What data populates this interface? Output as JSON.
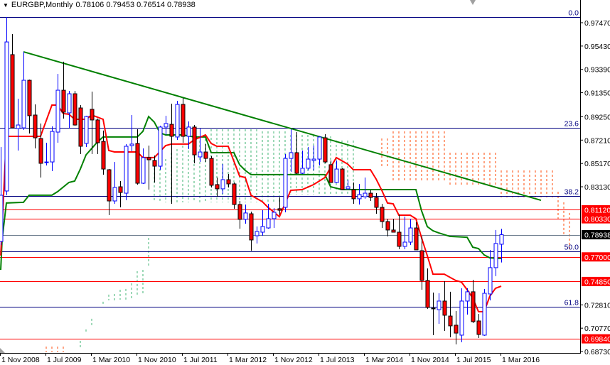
{
  "header": {
    "symbol": "EURGBP,Monthly",
    "ohlc": "0.78106 0.79453 0.76514 0.78938"
  },
  "colors": {
    "bull": "#0000ff",
    "bear": "#ff0000",
    "fib": "#000080",
    "level": "#ff0000",
    "trendline": "#008000",
    "red_line": "#ff0000",
    "green_line": "#008000",
    "cloud_green": "#3cb371",
    "cloud_orange": "#ff4500",
    "current_price": "#708090"
  },
  "chart_data": {
    "type": "candlestick",
    "title": "EURGBP,Monthly",
    "ylim": [
      0.6873,
      0.9797
    ],
    "y_ticks": [
      "0.97470",
      "0.95430",
      "0.93390",
      "0.91350",
      "0.89250",
      "0.87210",
      "0.85170",
      "0.83130",
      "0.72810",
      "0.70770",
      "0.68730"
    ],
    "x_ticks": [
      {
        "label": "1 Nov 2008",
        "index": 0
      },
      {
        "label": "1 Jul 2009",
        "index": 8
      },
      {
        "label": "1 Mar 2010",
        "index": 16
      },
      {
        "label": "1 Nov 2010",
        "index": 24
      },
      {
        "label": "1 Jul 2011",
        "index": 32
      },
      {
        "label": "1 Mar 2012",
        "index": 40
      },
      {
        "label": "1 Nov 2012",
        "index": 48
      },
      {
        "label": "1 Jul 2013",
        "index": 56
      },
      {
        "label": "1 Mar 2014",
        "index": 64
      },
      {
        "label": "1 Nov 2014",
        "index": 72
      },
      {
        "label": "1 Jul 2015",
        "index": 80
      },
      {
        "label": "1 Mar 2016",
        "index": 88
      }
    ],
    "candles_ohlc": [
      [
        0.7835,
        0.8661,
        0.7804,
        0.8239
      ],
      [
        0.8276,
        0.9797,
        0.8239,
        0.9579
      ],
      [
        0.9468,
        0.9648,
        0.8828,
        0.8828
      ],
      [
        0.8822,
        0.9083,
        0.863,
        0.8853
      ],
      [
        0.8828,
        0.9493,
        0.881,
        0.9244
      ],
      [
        0.9244,
        0.925,
        0.8779,
        0.8934
      ],
      [
        0.894,
        0.9033,
        0.8648,
        0.8741
      ],
      [
        0.8735,
        0.8866,
        0.8394,
        0.8518
      ],
      [
        0.8524,
        0.8698,
        0.8499,
        0.853
      ],
      [
        0.853,
        0.8841,
        0.845,
        0.8797
      ],
      [
        0.8791,
        0.93,
        0.8698,
        0.9157
      ],
      [
        0.9157,
        0.9406,
        0.8909,
        0.8965
      ],
      [
        0.8959,
        0.9151,
        0.8828,
        0.9126
      ],
      [
        0.9126,
        0.9151,
        0.8847,
        0.8853
      ],
      [
        0.9002,
        0.9027,
        0.8599,
        0.8667
      ],
      [
        0.8692,
        0.8934,
        0.8661,
        0.8928
      ],
      [
        0.899,
        0.9145,
        0.8599,
        0.8897
      ],
      [
        0.8897,
        0.8909,
        0.8599,
        0.8698
      ],
      [
        0.871,
        0.8804,
        0.8419,
        0.8468
      ],
      [
        0.8462,
        0.8468,
        0.8065,
        0.8189
      ],
      [
        0.8189,
        0.853,
        0.8164,
        0.8307
      ],
      [
        0.8313,
        0.8363,
        0.8133,
        0.8263
      ],
      [
        0.8257,
        0.8686,
        0.8195,
        0.8667
      ],
      [
        0.8673,
        0.894,
        0.8624,
        0.8686
      ],
      [
        0.8692,
        0.8816,
        0.8332,
        0.8344
      ],
      [
        0.8344,
        0.8648,
        0.8338,
        0.8568
      ],
      [
        0.8568,
        0.8673,
        0.8288,
        0.8549
      ],
      [
        0.8543,
        0.8586,
        0.835,
        0.8493
      ],
      [
        0.8493,
        0.8847,
        0.8462,
        0.8835
      ],
      [
        0.8835,
        0.8934,
        0.8766,
        0.8866
      ],
      [
        0.8859,
        0.9039,
        0.8164,
        0.8754
      ],
      [
        0.8748,
        0.9064,
        0.8723,
        0.9033
      ],
      [
        0.9033,
        0.9089,
        0.8698,
        0.8754
      ],
      [
        0.8754,
        0.8884,
        0.8642,
        0.8835
      ],
      [
        0.8835,
        0.8853,
        0.8518,
        0.8592
      ],
      [
        0.8574,
        0.8822,
        0.853,
        0.8617
      ],
      [
        0.8617,
        0.8686,
        0.853,
        0.8561
      ],
      [
        0.8561,
        0.858,
        0.8307,
        0.8326
      ],
      [
        0.8332,
        0.8394,
        0.8226,
        0.8295
      ],
      [
        0.8295,
        0.8512,
        0.8251,
        0.8375
      ],
      [
        0.8375,
        0.8425,
        0.8307,
        0.8338
      ],
      [
        0.8338,
        0.835,
        0.8121,
        0.8158
      ],
      [
        0.8158,
        0.8189,
        0.7947,
        0.8028
      ],
      [
        0.8028,
        0.8158,
        0.799,
        0.8084
      ],
      [
        0.8077,
        0.8096,
        0.7754,
        0.7848
      ],
      [
        0.7885,
        0.7966,
        0.7817,
        0.7922
      ],
      [
        0.7916,
        0.8108,
        0.7885,
        0.7966
      ],
      [
        0.7953,
        0.8164,
        0.7947,
        0.8034
      ],
      [
        0.8034,
        0.8127,
        0.7953,
        0.809
      ],
      [
        0.8121,
        0.822,
        0.8065,
        0.8108
      ],
      [
        0.8133,
        0.8599,
        0.809,
        0.8561
      ],
      [
        0.8561,
        0.8816,
        0.8444,
        0.8611
      ],
      [
        0.8611,
        0.8791,
        0.8425,
        0.8431
      ],
      [
        0.8431,
        0.863,
        0.8425,
        0.8475
      ],
      [
        0.8475,
        0.8661,
        0.8456,
        0.8555
      ],
      [
        0.8543,
        0.8673,
        0.8456,
        0.8555
      ],
      [
        0.8555,
        0.8754,
        0.8499,
        0.8748
      ],
      [
        0.8741,
        0.8773,
        0.8518,
        0.853
      ],
      [
        0.8506,
        0.8543,
        0.835,
        0.835
      ],
      [
        0.835,
        0.8543,
        0.8344,
        0.8468
      ],
      [
        0.8468,
        0.8475,
        0.8288,
        0.8288
      ],
      [
        0.8295,
        0.8375,
        0.8288,
        0.8313
      ],
      [
        0.8288,
        0.835,
        0.8164,
        0.8208
      ],
      [
        0.8208,
        0.8338,
        0.8158,
        0.8245
      ],
      [
        0.8226,
        0.8394,
        0.8208,
        0.8257
      ],
      [
        0.8257,
        0.8282,
        0.8189,
        0.822
      ],
      [
        0.822,
        0.8257,
        0.8077,
        0.8133
      ],
      [
        0.8133,
        0.8164,
        0.7953,
        0.8009
      ],
      [
        0.8009,
        0.8034,
        0.7879,
        0.7935
      ],
      [
        0.7935,
        0.8034,
        0.7916,
        0.7916
      ],
      [
        0.7916,
        0.8071,
        0.7767,
        0.7792
      ],
      [
        0.7792,
        0.8052,
        0.7767,
        0.7829
      ],
      [
        0.7829,
        0.8034,
        0.7804,
        0.7953
      ],
      [
        0.7953,
        0.8003,
        0.7761,
        0.7761
      ],
      [
        0.7754,
        0.7879,
        0.7413,
        0.7494
      ],
      [
        0.7494,
        0.7599,
        0.7246,
        0.7258
      ],
      [
        0.7252,
        0.7388,
        0.7016,
        0.7246
      ],
      [
        0.7239,
        0.7382,
        0.7115,
        0.7314
      ],
      [
        0.7314,
        0.7488,
        0.7053,
        0.719
      ],
      [
        0.7183,
        0.7395,
        0.6997,
        0.7097
      ],
      [
        0.7103,
        0.7227,
        0.6935,
        0.7034
      ],
      [
        0.7016,
        0.7426,
        0.6954,
        0.7314
      ],
      [
        0.7314,
        0.7426,
        0.7196,
        0.7395
      ],
      [
        0.7395,
        0.75,
        0.7121,
        0.7134
      ],
      [
        0.714,
        0.7202,
        0.6991,
        0.7022
      ],
      [
        0.7016,
        0.7419,
        0.701,
        0.7382
      ],
      [
        0.7376,
        0.7761,
        0.732,
        0.7606
      ],
      [
        0.7606,
        0.7935,
        0.7531,
        0.7817
      ],
      [
        0.78106,
        0.79453,
        0.76514,
        0.78938
      ]
    ],
    "red_line": [
      [
        0,
        0.7712
      ],
      [
        1,
        0.8754
      ],
      [
        7,
        0.8754
      ],
      [
        9,
        0.9027
      ],
      [
        10,
        0.9027
      ],
      [
        11,
        0.8953
      ],
      [
        12,
        0.8947
      ],
      [
        13,
        0.8903
      ],
      [
        15,
        0.8903
      ],
      [
        16,
        0.894
      ],
      [
        17,
        0.8922
      ],
      [
        18,
        0.8903
      ],
      [
        19,
        0.863
      ],
      [
        20,
        0.8617
      ],
      [
        24,
        0.8617
      ],
      [
        25,
        0.8568
      ],
      [
        27,
        0.8568
      ],
      [
        29,
        0.8673
      ],
      [
        30,
        0.8686
      ],
      [
        33,
        0.8686
      ],
      [
        34,
        0.8723
      ],
      [
        36,
        0.8766
      ],
      [
        37,
        0.8692
      ],
      [
        38,
        0.8667
      ],
      [
        40,
        0.8667
      ],
      [
        42,
        0.8406
      ],
      [
        43,
        0.8394
      ],
      [
        44,
        0.8239
      ],
      [
        46,
        0.8183
      ],
      [
        47,
        0.8133
      ],
      [
        49,
        0.8052
      ],
      [
        51,
        0.8282
      ],
      [
        53,
        0.8288
      ],
      [
        55,
        0.8332
      ],
      [
        57,
        0.8394
      ],
      [
        59,
        0.8568
      ],
      [
        61,
        0.8512
      ],
      [
        62,
        0.8462
      ],
      [
        65,
        0.8462
      ],
      [
        66,
        0.8381
      ],
      [
        67,
        0.8282
      ],
      [
        68,
        0.8171
      ],
      [
        69,
        0.8164
      ],
      [
        70,
        0.8065
      ],
      [
        72,
        0.8065
      ],
      [
        73,
        0.8034
      ],
      [
        74,
        0.7866
      ],
      [
        75,
        0.7711
      ],
      [
        76,
        0.7549
      ],
      [
        78,
        0.7549
      ],
      [
        80,
        0.7494
      ],
      [
        81,
        0.7481
      ],
      [
        82,
        0.7413
      ],
      [
        83,
        0.7339
      ],
      [
        84,
        0.7221
      ],
      [
        85,
        0.7221
      ],
      [
        86,
        0.7357
      ],
      [
        87,
        0.7426
      ],
      [
        88,
        0.7444
      ]
    ],
    "green_line": [
      [
        0,
        0.7587
      ],
      [
        0.25,
        0.7854
      ],
      [
        1,
        0.8171
      ],
      [
        4,
        0.8177
      ],
      [
        5,
        0.8239
      ],
      [
        9,
        0.8239
      ],
      [
        10,
        0.827
      ],
      [
        12,
        0.8351
      ],
      [
        13,
        0.8363
      ],
      [
        14,
        0.8468
      ],
      [
        15,
        0.8592
      ],
      [
        17,
        0.8704
      ],
      [
        18,
        0.8748
      ],
      [
        24,
        0.8748
      ],
      [
        25,
        0.8797
      ],
      [
        26,
        0.8927
      ],
      [
        27,
        0.8878
      ],
      [
        28,
        0.8785
      ],
      [
        29,
        0.8766
      ],
      [
        32,
        0.8766
      ],
      [
        34,
        0.8748
      ],
      [
        36,
        0.8748
      ],
      [
        37,
        0.8611
      ],
      [
        41,
        0.8611
      ],
      [
        42,
        0.8506
      ],
      [
        43,
        0.8456
      ],
      [
        44,
        0.8419
      ],
      [
        57,
        0.8419
      ],
      [
        58,
        0.8313
      ],
      [
        60,
        0.8288
      ],
      [
        73,
        0.8288
      ],
      [
        74,
        0.8102
      ],
      [
        75,
        0.7965
      ],
      [
        76,
        0.7928
      ],
      [
        77,
        0.791
      ],
      [
        79,
        0.7879
      ],
      [
        82,
        0.7872
      ],
      [
        83,
        0.7785
      ],
      [
        84,
        0.7773
      ],
      [
        85,
        0.7717
      ],
      [
        86,
        0.7692
      ],
      [
        88,
        0.7686
      ]
    ],
    "trendline": {
      "from": [
        4,
        0.9493
      ],
      "to": [
        95,
        0.8195
      ]
    },
    "cloud_green": [
      [
        14,
        0.6966,
        0.6904
      ],
      [
        15,
        0.7066,
        0.7035
      ],
      [
        16,
        0.7159,
        0.7097
      ],
      [
        18,
        0.7308,
        0.7289
      ],
      [
        19,
        0.737,
        0.732
      ],
      [
        20,
        0.7376,
        0.732
      ],
      [
        21,
        0.7413,
        0.7326
      ],
      [
        22,
        0.742,
        0.7326
      ],
      [
        23,
        0.7469,
        0.7326
      ],
      [
        24,
        0.7575,
        0.737
      ],
      [
        25,
        0.7587,
        0.7382
      ],
      [
        26,
        0.7866,
        0.7606
      ],
      [
        27,
        0.8475,
        0.8177
      ],
      [
        28,
        0.8506,
        0.8177
      ],
      [
        29,
        0.8555,
        0.8177
      ],
      [
        30,
        0.8611,
        0.8177
      ],
      [
        31,
        0.8642,
        0.8177
      ],
      [
        32,
        0.8673,
        0.8177
      ],
      [
        33,
        0.8704,
        0.8177
      ],
      [
        34,
        0.8735,
        0.8177
      ],
      [
        35,
        0.8754,
        0.8177
      ],
      [
        36,
        0.8766,
        0.8177
      ],
      [
        37,
        0.8816,
        0.8177
      ],
      [
        38,
        0.8816,
        0.8177
      ],
      [
        39,
        0.8816,
        0.8177
      ],
      [
        40,
        0.8816,
        0.8177
      ],
      [
        41,
        0.8816,
        0.8177
      ],
      [
        42,
        0.8816,
        0.8177
      ],
      [
        43,
        0.8816,
        0.8177
      ],
      [
        44,
        0.8816,
        0.8177
      ],
      [
        45,
        0.8816,
        0.8177
      ],
      [
        46,
        0.8797,
        0.8177
      ],
      [
        47,
        0.8797,
        0.8177
      ],
      [
        48,
        0.8797,
        0.8177
      ],
      [
        49,
        0.8797,
        0.8177
      ],
      [
        50,
        0.8797,
        0.8177
      ],
      [
        51,
        0.8766,
        0.8239
      ],
      [
        52,
        0.8766,
        0.8239
      ],
      [
        53,
        0.8766,
        0.8239
      ],
      [
        54,
        0.8766,
        0.8239
      ],
      [
        55,
        0.8766,
        0.8239
      ],
      [
        56,
        0.8754,
        0.8239
      ],
      [
        57,
        0.8754,
        0.8239
      ],
      [
        58,
        0.8754,
        0.8239
      ],
      [
        59,
        0.8717,
        0.8239
      ],
      [
        60,
        0.8717,
        0.8239
      ],
      [
        61,
        0.8717,
        0.8239
      ],
      [
        62,
        0.8717,
        0.8239
      ]
    ],
    "cloud_orange": [
      [
        8,
        0.6916,
        0.6867
      ],
      [
        9,
        0.6916,
        0.6867
      ],
      [
        10,
        0.6916,
        0.6867
      ],
      [
        11,
        0.6916,
        0.6867
      ],
      [
        67,
        0.8735,
        0.8487
      ],
      [
        68,
        0.8735,
        0.8487
      ],
      [
        69,
        0.8797,
        0.8363
      ],
      [
        70,
        0.8797,
        0.8363
      ],
      [
        71,
        0.8797,
        0.8363
      ],
      [
        72,
        0.8797,
        0.8363
      ],
      [
        73,
        0.8797,
        0.8363
      ],
      [
        74,
        0.8797,
        0.8363
      ],
      [
        75,
        0.8797,
        0.8363
      ],
      [
        76,
        0.8797,
        0.8363
      ],
      [
        77,
        0.8797,
        0.8363
      ],
      [
        78,
        0.8797,
        0.8363
      ],
      [
        79,
        0.8611,
        0.8319
      ],
      [
        80,
        0.8611,
        0.8319
      ],
      [
        81,
        0.8611,
        0.8319
      ],
      [
        82,
        0.8611,
        0.8319
      ],
      [
        83,
        0.8611,
        0.8319
      ],
      [
        84,
        0.8611,
        0.8319
      ],
      [
        85,
        0.8611,
        0.8319
      ],
      [
        86,
        0.8611,
        0.8319
      ],
      [
        87,
        0.8611,
        0.8319
      ],
      [
        88,
        0.8456,
        0.822
      ],
      [
        89,
        0.8456,
        0.822
      ],
      [
        90,
        0.8456,
        0.822
      ],
      [
        91,
        0.8456,
        0.822
      ],
      [
        92,
        0.8456,
        0.822
      ],
      [
        93,
        0.8456,
        0.822
      ],
      [
        94,
        0.8456,
        0.822
      ],
      [
        95,
        0.8456,
        0.822
      ],
      [
        96,
        0.8456,
        0.822
      ],
      [
        97,
        0.8456,
        0.822
      ],
      [
        98,
        0.827,
        0.8009
      ],
      [
        99,
        0.8177,
        0.7897
      ],
      [
        100,
        0.8084,
        0.7742
      ]
    ],
    "fib_levels": [
      {
        "label": "0.0",
        "price": 0.9797
      },
      {
        "label": "23.6",
        "price": 0.8828
      },
      {
        "label": "38.2",
        "price": 0.8233
      },
      {
        "label": "50.0",
        "price": 0.7748
      },
      {
        "label": "61.8",
        "price": 0.7265
      }
    ],
    "price_levels": [
      {
        "label": "0.81120",
        "price": 0.8112
      },
      {
        "label": "0.80330",
        "price": 0.8033
      },
      {
        "label": "0.77000",
        "price": 0.77
      },
      {
        "label": "0.74850",
        "price": 0.7485
      },
      {
        "label": "0.69840",
        "price": 0.6984
      }
    ],
    "current_price": {
      "label": "0.78938",
      "price": 0.78938
    }
  }
}
